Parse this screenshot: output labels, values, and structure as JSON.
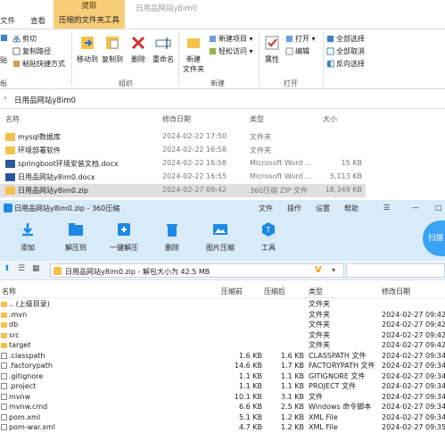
{
  "explorer": {
    "window_title": "日用品网站y8im0",
    "tabs": [
      "文件",
      "主页",
      "共享",
      "查看"
    ],
    "contextual_tab_top": "提取",
    "contextual_tab": "压缩的文件夹工具",
    "clipboard": {
      "paste": "贴",
      "cut": "剪切",
      "copy_path": "复制路径",
      "paste_shortcut": "粘贴快捷方式",
      "group": "板"
    },
    "organize": {
      "move_to": "移动到",
      "copy_to": "复制到",
      "delete": "删除",
      "rename": "重命名",
      "group": "组织"
    },
    "new": {
      "new_folder_1": "新建",
      "new_folder_2": "文件夹",
      "new_item": "新建项目 ▾",
      "easy_access": "轻松访问 ▾",
      "group": "新建"
    },
    "open": {
      "properties": "属性",
      "open": "打开 ▾",
      "edit": "编辑",
      "group": "打开"
    },
    "select": {
      "select_all": "全部选择",
      "select_none": "全部取消",
      "invert": "反向选择"
    },
    "address": "日用品网站y8im0",
    "columns": [
      "名称",
      "修改日期",
      "类型",
      "大小"
    ],
    "files": [
      {
        "name": "mysql数据库",
        "date": "2024-02-22 17:50",
        "type": "文件夹",
        "size": "",
        "kind": "folder"
      },
      {
        "name": "环境部署软件",
        "date": "2024-02-22 16:58",
        "type": "文件夹",
        "size": "",
        "kind": "folder"
      },
      {
        "name": "springboot环境安装文档.docx",
        "date": "2024-02-22 16:58",
        "type": "Microsoft Word ...",
        "size": "15 KB",
        "kind": "doc"
      },
      {
        "name": "日用品网站y8im0.docx",
        "date": "2024-02-22 16:55",
        "type": "Microsoft Word ...",
        "size": "5,113 KB",
        "kind": "doc"
      },
      {
        "name": "日用品网站y8im0.zip",
        "date": "2024-02-27 09:42",
        "type": "360压缩 ZIP 文件",
        "size": "18,349 KB",
        "kind": "zip",
        "selected": true
      }
    ]
  },
  "zip": {
    "title": "日用品网站y8im0.zip - 360压缩",
    "menu": [
      "文件",
      "操作",
      "设置",
      "帮助"
    ],
    "tools": [
      "添加",
      "解压到",
      "一键解压",
      "删除",
      "图片压缩",
      "工具"
    ],
    "scan_label": "扫描",
    "path_text": "日用品网站y8im0.zip - 解包大小为 42.5 MB",
    "columns": [
      "名称",
      "压缩前",
      "压缩后",
      "类型",
      "修改日期"
    ],
    "rows": [
      {
        "name": ".. (上级目录)",
        "size": "",
        "csize": "",
        "type": "文件夹",
        "date": "",
        "kind": "up"
      },
      {
        "name": ".mvn",
        "size": "",
        "csize": "",
        "type": "文件夹",
        "date": "2024-02-27 09:42",
        "kind": "folder"
      },
      {
        "name": "db",
        "size": "",
        "csize": "",
        "type": "文件夹",
        "date": "2024-02-27 09:42",
        "kind": "folder"
      },
      {
        "name": "src",
        "size": "",
        "csize": "",
        "type": "文件夹",
        "date": "2024-02-27 09:42",
        "kind": "folder"
      },
      {
        "name": "target",
        "size": "",
        "csize": "",
        "type": "文件夹",
        "date": "2024-02-27 09:42",
        "kind": "folder"
      },
      {
        "name": ".classpath",
        "size": "1.6 KB",
        "csize": "1.6 KB",
        "type": "CLASSPATH 文件",
        "date": "2024-02-27 09:34",
        "kind": "file"
      },
      {
        "name": ".factorypath",
        "size": "14.6 KB",
        "csize": "1.7 KB",
        "type": "FACTORYPATH 文件",
        "date": "2024-02-27 09:34",
        "kind": "file"
      },
      {
        "name": ".gitignore",
        "size": "1.1 KB",
        "csize": "1.1 KB",
        "type": "GITIGNORE 文件",
        "date": "2024-02-27 09:34",
        "kind": "file"
      },
      {
        "name": ".project",
        "size": "1.1 KB",
        "csize": "1.1 KB",
        "type": "PROJECT 文件",
        "date": "2024-02-27 09:34",
        "kind": "file"
      },
      {
        "name": "mvnw",
        "size": "10.1 KB",
        "csize": "3.1 KB",
        "type": "文件",
        "date": "2024-02-27 09:34",
        "kind": "file"
      },
      {
        "name": "mvnw.cmd",
        "size": "6.6 KB",
        "csize": "2.5 KB",
        "type": "Windows 命令脚本",
        "date": "2024-02-27 09:34",
        "kind": "file"
      },
      {
        "name": "pom.xml",
        "size": "5.1 KB",
        "csize": "1.2 KB",
        "type": "XML File",
        "date": "2024-02-27 09:34",
        "kind": "file"
      },
      {
        "name": "pom-war.xml",
        "size": "4.7 KB",
        "csize": "1.2 KB",
        "type": "XML File",
        "date": "2024-02-27 09:35",
        "kind": "file"
      }
    ]
  },
  "colors": {
    "contextual_tab": "#f6ce79",
    "zip_header": "#d8ebfb",
    "zip_accent": "#1e88e5",
    "folder": "#f3c24b"
  }
}
